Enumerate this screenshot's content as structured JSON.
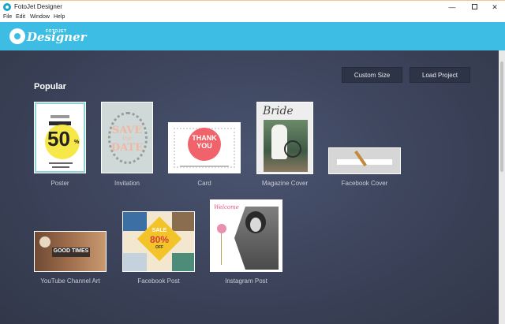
{
  "window": {
    "title": "FotoJet Designer",
    "controls": {
      "minimize": "—",
      "close": "✕"
    }
  },
  "menu": [
    "File",
    "Edit",
    "Window",
    "Help"
  ],
  "header": {
    "logo_small": "FOTOJET",
    "logo_text": "Designer",
    "color": "#3dbde4"
  },
  "toolbar": {
    "custom_size": "Custom Size",
    "load_project": "Load Project"
  },
  "section": {
    "title": "Popular"
  },
  "templates": [
    {
      "label": "Poster",
      "art": {
        "number": "50",
        "unit": "%"
      }
    },
    {
      "label": "Invitation",
      "art": {
        "line1": "SAVE",
        "line2": "the",
        "line3": "DATE"
      }
    },
    {
      "label": "Card",
      "art": {
        "line1": "THANK",
        "line2": "YOU"
      }
    },
    {
      "label": "Magazine Cover",
      "art": {
        "word": "Bride"
      }
    },
    {
      "label": "Facebook Cover"
    },
    {
      "label": "YouTube Channel Art",
      "art": {
        "band": "GOOD TIMES"
      }
    },
    {
      "label": "Facebook Post",
      "art": {
        "sale": "SALE",
        "number": "80%",
        "off": "OFF"
      }
    },
    {
      "label": "Instagram Post",
      "art": {
        "welcome": "Welcome"
      }
    }
  ],
  "colors": {
    "canvas": "#3a4158",
    "button_bg": "#2e3447",
    "label_text": "#c8ccd6"
  }
}
